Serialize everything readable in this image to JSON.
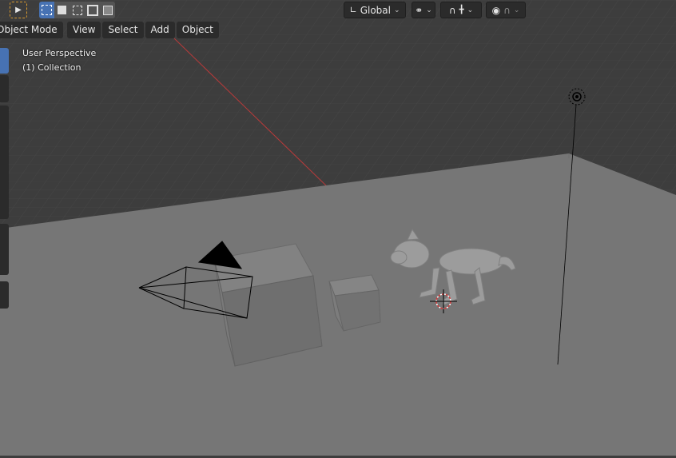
{
  "header": {
    "transform_orientation": "Global",
    "icons": [
      "select-box-icon",
      "select-mode-new-icon",
      "select-mode-extend-icon",
      "select-mode-subtract-icon",
      "select-mode-intersect-icon",
      "transform-orientation-icon",
      "pivot-point-icon",
      "snap-icon",
      "snap-increment-icon",
      "proportional-editing-icon",
      "falloff-icon"
    ]
  },
  "menu": {
    "mode": "Object Mode",
    "view": "View",
    "select": "Select",
    "add": "Add",
    "object": "Object"
  },
  "viewport": {
    "perspective_label": "User Perspective",
    "collection_label": "(1) Collection",
    "objects": [
      "camera",
      "cube-large",
      "cube-small",
      "dog",
      "light",
      "3d-cursor"
    ]
  },
  "colors": {
    "background": "#3d3d3d",
    "ground": "#767676",
    "active_tool": "#4772b3",
    "x_axis": "#b83a3a",
    "tool_outline": "#d99a2e"
  }
}
